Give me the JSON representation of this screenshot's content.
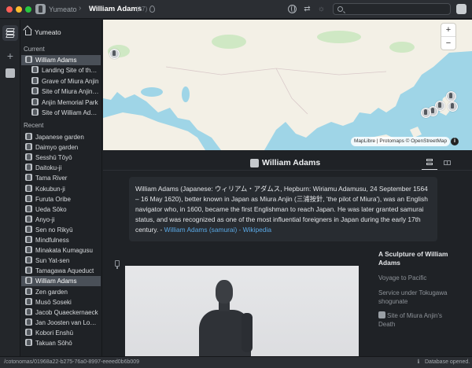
{
  "titlebar": {
    "app_name": "Yumeato",
    "title": "William Adams",
    "count": "(17)",
    "search_placeholder": ""
  },
  "sidebar": {
    "home_label": "Yumeato",
    "current_title": "Current",
    "current_items": [
      "William Adams",
      "Landing Site of the L...",
      "Grave of Miura Anjin",
      "Site of Miura Anjin's ...",
      "Anjin Memorial Park",
      "Site of William Adam..."
    ],
    "recent_title": "Recent",
    "recent_items": [
      "Japanese garden",
      "Daimyo garden",
      "Sesshū Tōyō",
      "Daitoku-ji",
      "Tama River",
      "Kokubun-ji",
      "Furuta Oribe",
      "Ueda Sōko",
      "Anyo-ji",
      "Sen no Rikyū",
      "Mindfulness",
      "Minakata Kumagusu",
      "Sun Yat-sen",
      "Tamagawa Aqueduct",
      "William Adams",
      "Zen garden",
      "Musō Soseki",
      "Jacob Quaeckernaeck",
      "Jan Joosten van Lode...",
      "Kobori Enshū",
      "Takuan Sōhō"
    ]
  },
  "map": {
    "zoom_in": "+",
    "zoom_out": "−",
    "attribution": "MapLibre | Protomaps © OpenStreetMap",
    "info": "i",
    "land_color": "#f3f0e6",
    "water_color": "#9fd5e7",
    "park_color": "#cfe8c4"
  },
  "entity": {
    "title": "William Adams",
    "description": "William Adams (Japanese: ウィリアム・アダムス, Hepburn: Wiriamu Adamusu, 24 September 1564 – 16 May 1620), better known in Japan as Miura Anjin (三浦按針, 'the pilot of Miura'), was an English navigator who, in 1600, became the first Englishman to reach Japan. He was later granted samurai status, and was recognized as one of the most influential foreigners in Japan during the early 17th century. - ",
    "link": "William Adams (samurai) - Wikipedia"
  },
  "toc": {
    "title": "A Sculpture of William Adams",
    "items": [
      "Voyage to Pacific",
      "Service under Tokugawa shogunate",
      "Site of Miura Anjin's Death"
    ]
  },
  "statusbar": {
    "path": "/cotonomas/01968a22-b275-76a0-8997-eeeed0b6b009",
    "info": "Database opened."
  }
}
